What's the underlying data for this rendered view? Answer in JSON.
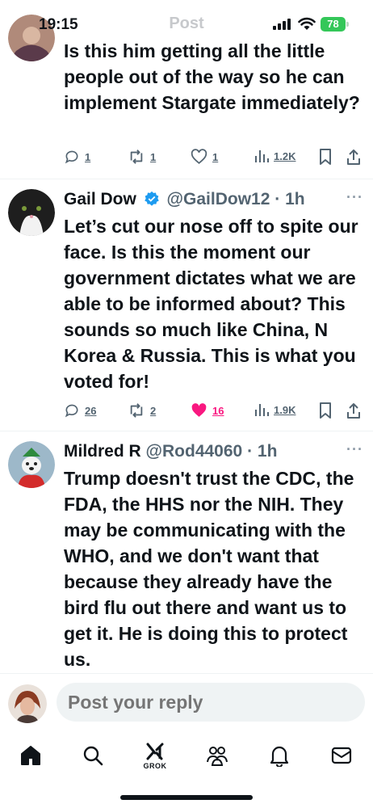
{
  "status_bar": {
    "time": "19:15",
    "battery": "78"
  },
  "header": {
    "title": "Post"
  },
  "tweets": [
    {
      "text": "Is this him getting all the little people out of the way so he can implement Stargate immediately?",
      "actions": {
        "replies": "1",
        "reposts": "1",
        "likes": "1",
        "views": "1.2K"
      }
    },
    {
      "name": "Gail Dow",
      "handle": "@GailDow12",
      "time": "· 1h",
      "verified": true,
      "text": "Let’s cut our nose off to spite our face. Is this the moment our government dictates what we are able to be informed about? This sounds so much like China, N Korea & Russia. This is what you voted for!",
      "actions": {
        "replies": "26",
        "reposts": "2",
        "likes": "16",
        "views": "1.9K"
      }
    },
    {
      "name": "Mildred R",
      "handle": "@Rod44060",
      "time": "· 1h",
      "text": "Trump doesn't trust the CDC, the FDA, the HHS nor the NIH. They may be communicating with the WHO, and we don't want that because they already have the bird flu out there and want us to get it. He is doing this to protect us."
    }
  ],
  "reply": {
    "placeholder": "Post your reply"
  },
  "nav": {
    "items": [
      {
        "icon": "home-icon"
      },
      {
        "icon": "search-icon"
      },
      {
        "icon": "grok-icon",
        "label": "GROK"
      },
      {
        "icon": "communities-icon"
      },
      {
        "icon": "notifications-icon"
      },
      {
        "icon": "messages-icon"
      }
    ]
  },
  "colors": {
    "like": "#f91880",
    "verified": "#1d9bf0",
    "battery": "#34c759",
    "muted": "#536471"
  }
}
